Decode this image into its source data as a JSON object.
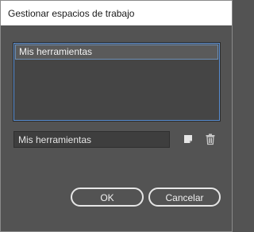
{
  "dialog": {
    "title": "Gestionar espacios de trabajo"
  },
  "workspace_list": {
    "items": [
      {
        "label": "Mis herramientas",
        "selected": true
      }
    ]
  },
  "name_field": {
    "value": "Mis herramientas"
  },
  "icons": {
    "new": "new-workspace-icon",
    "delete": "trash-icon"
  },
  "buttons": {
    "ok_label": "OK",
    "cancel_label": "Cancelar"
  },
  "colors": {
    "background": "#535353",
    "list_background": "#454545",
    "selection_border": "#6e8fb5",
    "button_border": "#e6e6e6"
  }
}
